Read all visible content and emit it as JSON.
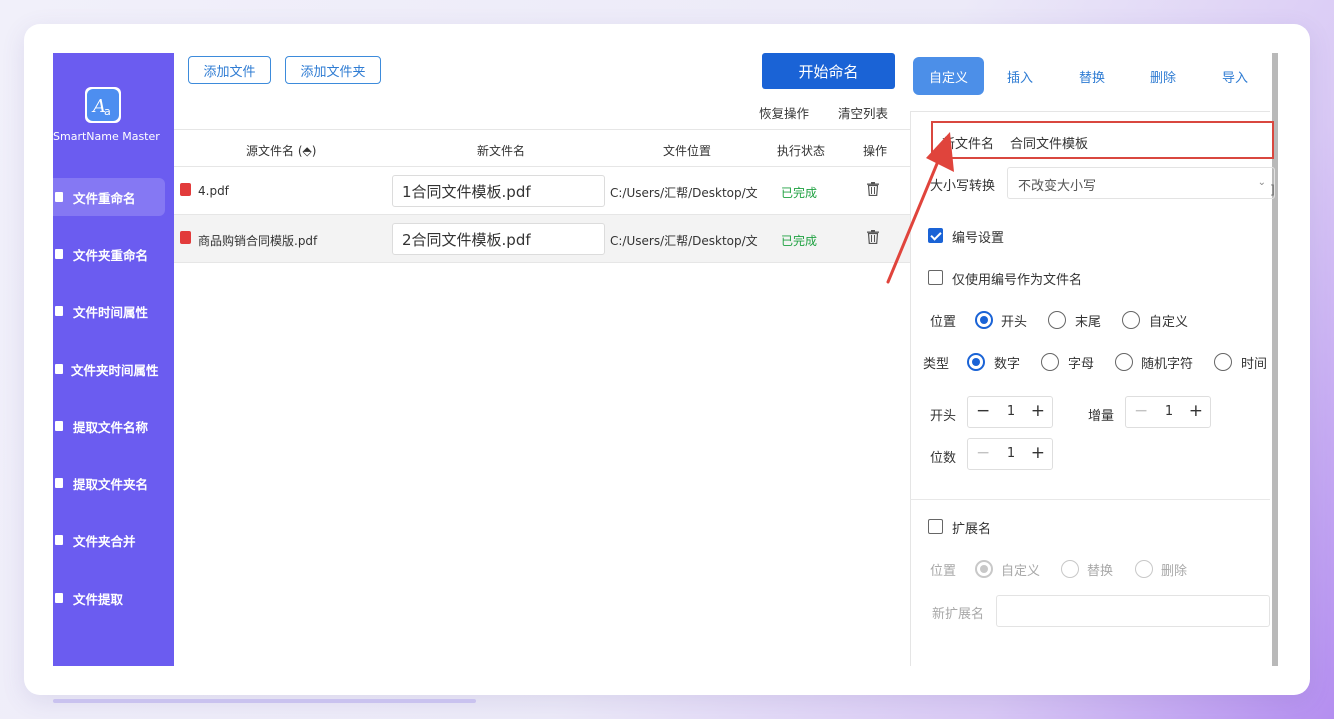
{
  "app": {
    "logo_text": "SmartName Master"
  },
  "sidebar": {
    "items": [
      {
        "label": "文件重命名",
        "active": true
      },
      {
        "label": "文件夹重命名",
        "active": false
      },
      {
        "label": "文件时间属性",
        "active": false
      },
      {
        "label": "文件夹时间属性",
        "active": false
      },
      {
        "label": "提取文件名称",
        "active": false
      },
      {
        "label": "提取文件夹名",
        "active": false
      },
      {
        "label": "文件夹合并",
        "active": false
      },
      {
        "label": "文件提取",
        "active": false
      }
    ]
  },
  "toolbar": {
    "add_file": "添加文件",
    "add_folder": "添加文件夹",
    "start_rename": "开始命名",
    "undo": "恢复操作",
    "clear_list": "清空列表"
  },
  "table": {
    "headers": {
      "source": "源文件名",
      "new_name": "新文件名",
      "location": "文件位置",
      "status": "执行状态",
      "action": "操作"
    },
    "rows": [
      {
        "source": "4.pdf",
        "new_name": "1合同文件模板.pdf",
        "location": "C:/Users/汇帮/Desktop/文件",
        "status": "已完成"
      },
      {
        "source": "商品购销合同模版.pdf",
        "new_name": "2合同文件模板.pdf",
        "location": "C:/Users/汇帮/Desktop/文件",
        "status": "已完成"
      }
    ]
  },
  "panel": {
    "tabs": [
      "自定义",
      "插入",
      "替换",
      "删除",
      "导入"
    ],
    "new_name_label": "新文件名",
    "new_name_value": "合同文件模板",
    "case_label": "大小写转换",
    "case_value": "不改变大小写",
    "numbering_label": "编号设置",
    "numbering_only_label": "仅使用编号作为文件名",
    "position_label": "位置",
    "position_options": [
      "开头",
      "末尾",
      "自定义"
    ],
    "type_label": "类型",
    "type_options": [
      "数字",
      "字母",
      "随机字符",
      "时间"
    ],
    "start_label": "开头",
    "start_value": "1",
    "increment_label": "增量",
    "increment_value": "1",
    "digits_label": "位数",
    "digits_value": "1",
    "extension_label": "扩展名",
    "ext_position_label": "位置",
    "ext_position_options": [
      "自定义",
      "替换",
      "删除"
    ],
    "new_ext_label": "新扩展名",
    "side_mark": "]"
  },
  "colors": {
    "sidebar": "#6b5cf0",
    "primary": "#1a63d6",
    "status_done": "#1fa141",
    "highlight": "#d9473f"
  }
}
